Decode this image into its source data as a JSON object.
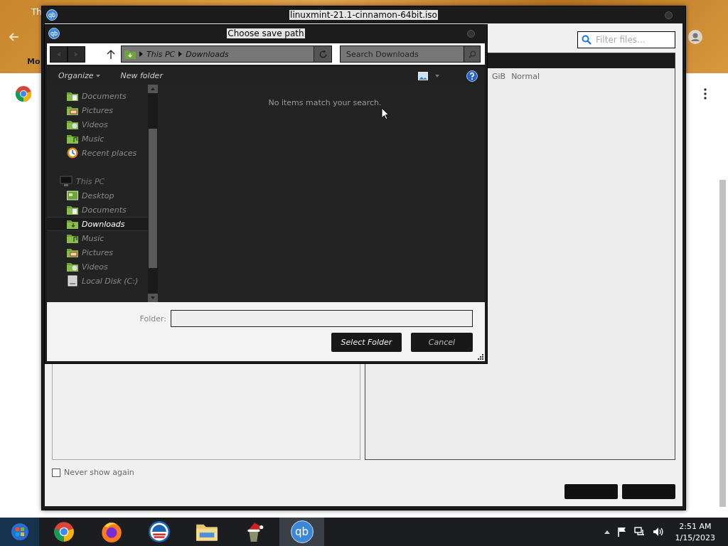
{
  "browser": {
    "tab_text": "Th",
    "bookmark_text": "Mo"
  },
  "main_window": {
    "icon_text": "qb",
    "title": "linuxmint-21.1-cinnamon-64bit.iso",
    "filter": {
      "placeholder": "Filter files..."
    },
    "row": [
      "GiB",
      "Normal"
    ],
    "never_show_again": {
      "label": "Never show again",
      "checked": false
    }
  },
  "dialog": {
    "icon_text": "qb",
    "title": "Choose save path",
    "breadcrumb": [
      "This PC",
      "Downloads"
    ],
    "search": {
      "placeholder": "Search Downloads"
    },
    "toolbar": [
      {
        "label": "Organize",
        "kind": "menu"
      },
      {
        "label": "New folder",
        "kind": "button"
      }
    ],
    "sidebar": [
      {
        "children": [
          {
            "label": "Documents",
            "kind": "documents",
            "selected": false
          },
          {
            "label": "Pictures",
            "kind": "pictures",
            "selected": false
          },
          {
            "label": "Videos",
            "kind": "videos",
            "selected": false
          },
          {
            "label": "Music",
            "kind": "music",
            "selected": false
          },
          {
            "label": "Recent places",
            "kind": "recent",
            "selected": false
          }
        ]
      },
      {
        "label": "This PC",
        "kind": "computer",
        "selected": false,
        "children": [
          {
            "label": "Desktop",
            "kind": "desktop",
            "selected": false
          },
          {
            "label": "Documents",
            "kind": "documents",
            "selected": false
          },
          {
            "label": "Downloads",
            "kind": "downloads",
            "selected": true
          },
          {
            "label": "Music",
            "kind": "music",
            "selected": false
          },
          {
            "label": "Pictures",
            "kind": "pictures",
            "selected": false
          },
          {
            "label": "Videos",
            "kind": "videos",
            "selected": false
          },
          {
            "label": "Local Disk (C:)",
            "kind": "disk",
            "selected": false
          }
        ]
      }
    ],
    "empty_message": "No items match your search.",
    "folder_label": "Folder:",
    "buttons": [
      {
        "label": "Select Folder",
        "kind": "primary"
      },
      {
        "label": "Cancel",
        "kind": "secondary"
      }
    ]
  },
  "taskbar": {
    "apps": [
      {
        "kind": "chrome",
        "selected": false
      },
      {
        "kind": "firefox",
        "selected": false
      },
      {
        "kind": "badge",
        "selected": false
      },
      {
        "kind": "folder",
        "selected": false
      },
      {
        "kind": "figure",
        "selected": false
      },
      {
        "kind": "qb",
        "text": "qb",
        "selected": true
      }
    ],
    "time": "2:51 AM",
    "date": "1/15/2023"
  }
}
